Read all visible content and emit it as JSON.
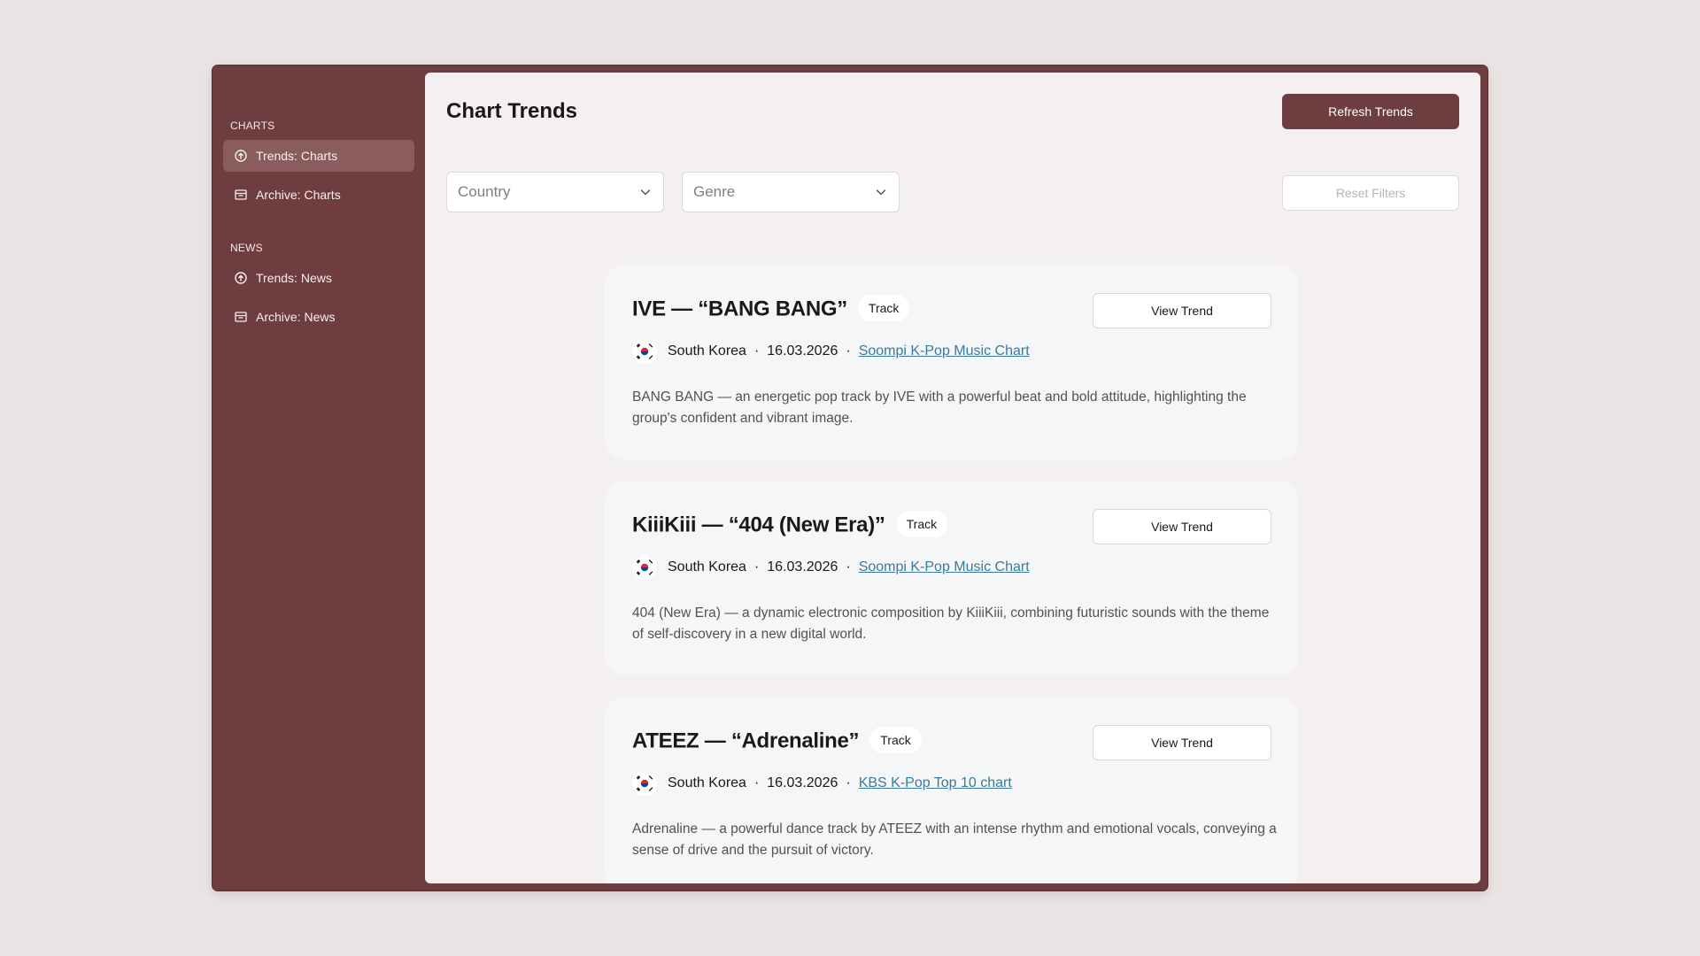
{
  "sidebar": {
    "sections": [
      {
        "title": "CHARTS",
        "items": [
          {
            "label": "Trends: Charts",
            "icon": "trend-circle-icon",
            "active": true
          },
          {
            "label": "Archive: Charts",
            "icon": "archive-box-icon",
            "active": false
          }
        ]
      },
      {
        "title": "NEWS",
        "items": [
          {
            "label": "Trends: News",
            "icon": "trend-circle-icon",
            "active": false
          },
          {
            "label": "Archive: News",
            "icon": "archive-box-icon",
            "active": false
          }
        ]
      }
    ]
  },
  "header": {
    "title": "Chart Trends",
    "refresh_label": "Refresh Trends"
  },
  "filters": {
    "country_placeholder": "Country",
    "genre_placeholder": "Genre",
    "reset_label": "Reset Filters"
  },
  "cards": [
    {
      "title": "IVE — “BANG BANG”",
      "badge": "Track",
      "view_label": "View Trend",
      "country": "South Korea",
      "date": "16.03.2026",
      "source": "Soompi K-Pop Music Chart",
      "description": "BANG BANG — an energetic pop track by IVE with a powerful beat and bold attitude, highlighting the group's confident and vibrant image."
    },
    {
      "title": "KiiiKiii — “404 (New Era)”",
      "badge": "Track",
      "view_label": "View Trend",
      "country": "South Korea",
      "date": "16.03.2026",
      "source": "Soompi K-Pop Music Chart",
      "description": "404 (New Era) — a dynamic electronic composition by KiiiKiii, combining futuristic sounds with the theme of self-discovery in a new digital world."
    },
    {
      "title": "ATEEZ — “Adrenaline”",
      "badge": "Track",
      "view_label": "View Trend",
      "country": "South Korea",
      "date": "16.03.2026",
      "source": "KBS K-Pop Top 10 chart",
      "description": "Adrenaline — a powerful dance track by ATEEZ with an intense rhythm and emotional vocals, conveying a sense of drive and the pursuit of victory."
    }
  ],
  "colors": {
    "sidebar_bg": "#6e3d3f",
    "sidebar_active": "#8a5c5e",
    "primary_button": "#6e3d3f",
    "link": "#3b7a9c",
    "card_bg": "#f5f6f8"
  }
}
